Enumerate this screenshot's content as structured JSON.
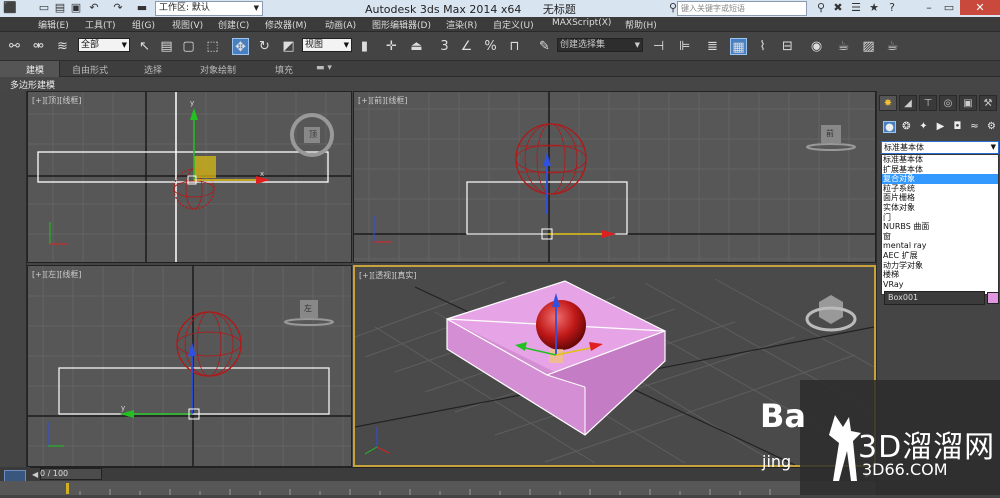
{
  "titlebar": {
    "workspace_label": "工作区: 默认",
    "app_title": "Autodesk 3ds Max  2014 x64",
    "doc_title": "无标题",
    "search_placeholder": "键入关键字或短语"
  },
  "menu": [
    "编辑(E)",
    "工具(T)",
    "组(G)",
    "视图(V)",
    "创建(C)",
    "修改器(M)",
    "动画(A)",
    "图形编辑器(D)",
    "渲染(R)",
    "自定义(U)",
    "MAXScript(X)",
    "帮助(H)"
  ],
  "toolbar": {
    "selection_filter": "全部",
    "ref_coord": "视图",
    "named_selection": "创建选择集"
  },
  "ribbon": {
    "tabs": [
      "建模",
      "自由形式",
      "选择",
      "对象绘制",
      "填充"
    ],
    "subtab": "多边形建模"
  },
  "viewports": {
    "top": {
      "plus": "[+]",
      "name": "[顶]",
      "mode": "[线框]",
      "cube": "顶"
    },
    "front": {
      "plus": "[+]",
      "name": "[前]",
      "mode": "[线框]",
      "cube": "前"
    },
    "left": {
      "plus": "[+]",
      "name": "[左]",
      "mode": "[线框]",
      "cube": "左"
    },
    "persp": {
      "plus": "[+]",
      "name": "[透视]",
      "mode": "[真实]"
    }
  },
  "command_panel": {
    "category_selected": "标准基本体",
    "categories": [
      "标准基本体",
      "扩展基本体",
      "复合对象",
      "粒子系统",
      "面片栅格",
      "实体对象",
      "门",
      "NURBS 曲面",
      "窗",
      "mental ray",
      "AEC 扩展",
      "动力学对象",
      "楼梯",
      "VRay"
    ],
    "highlighted_category": "复合对象",
    "object_name": "Box001",
    "object_color": "#e096e0"
  },
  "timeline": {
    "frame_counter": "0 / 100"
  },
  "watermark": {
    "brand": "3D溜溜网",
    "domain": "3D66.COM",
    "baidu": "Ba",
    "jing": "jing"
  }
}
